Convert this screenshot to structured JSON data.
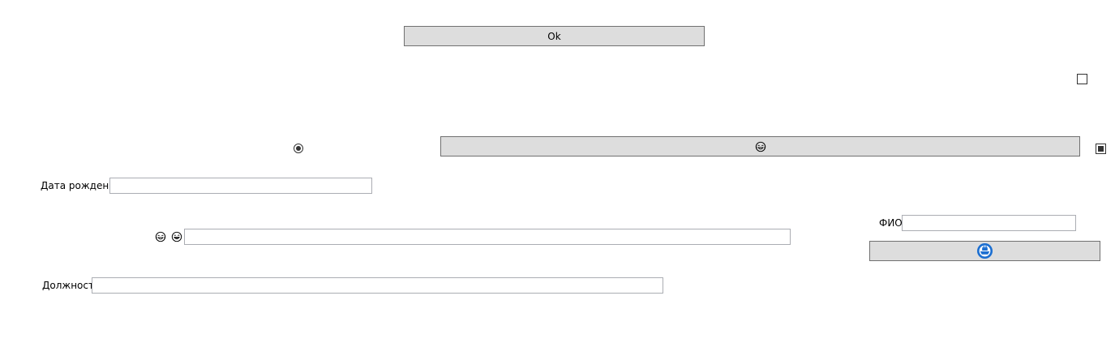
{
  "form": {
    "ok_button": {
      "label": "Ok"
    },
    "emoji_button": {
      "icon": "laughing-tears-face-icon"
    },
    "ship_button": {
      "icon": "ship-emblem-icon",
      "color": "#1c6fd1"
    },
    "birth_date": {
      "label": "Дата рождения",
      "value": ""
    },
    "full_name": {
      "label": "ФИО",
      "value": ""
    },
    "position": {
      "label": "Должность",
      "value": ""
    },
    "emoji_field": {
      "icons": [
        "laughing-tears-face-icon",
        "grinning-face-icon"
      ],
      "value": ""
    },
    "checkbox_top": {
      "checked": false
    },
    "checkbox_right": {
      "checked": true
    },
    "radio": {
      "selected": true
    }
  }
}
